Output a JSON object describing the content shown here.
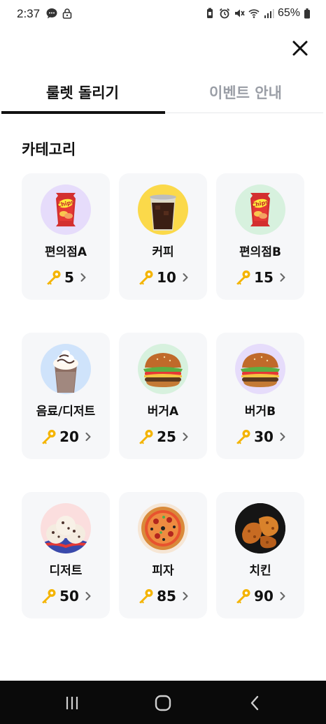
{
  "status": {
    "time": "2:37",
    "battery": "65%"
  },
  "header": {
    "close_icon": "close-icon"
  },
  "tabs": [
    {
      "label": "룰렛 돌리기",
      "active": true
    },
    {
      "label": "이벤트 안내",
      "active": false
    }
  ],
  "section_title": "카테고리",
  "colors": {
    "key": "#F4B400",
    "card_bg": "#F6F7F9",
    "active_tab": "#111111",
    "inactive_tab": "#9A9EA6"
  },
  "categories": [
    {
      "name": "편의점A",
      "cost": "5",
      "icon": "chips-icon"
    },
    {
      "name": "커피",
      "cost": "10",
      "icon": "iced-coffee-icon"
    },
    {
      "name": "편의점B",
      "cost": "15",
      "icon": "chips-icon"
    },
    {
      "name": "음료/디저트",
      "cost": "20",
      "icon": "frappe-icon"
    },
    {
      "name": "버거A",
      "cost": "25",
      "icon": "burger-icon"
    },
    {
      "name": "버거B",
      "cost": "30",
      "icon": "burger-icon"
    },
    {
      "name": "디저트",
      "cost": "50",
      "icon": "ice-cream-icon"
    },
    {
      "name": "피자",
      "cost": "85",
      "icon": "pizza-icon"
    },
    {
      "name": "치킨",
      "cost": "90",
      "icon": "fried-chicken-icon"
    }
  ],
  "chips_label": "Chips",
  "nav": {
    "recents": "recents-icon",
    "home": "home-icon",
    "back": "back-icon"
  }
}
